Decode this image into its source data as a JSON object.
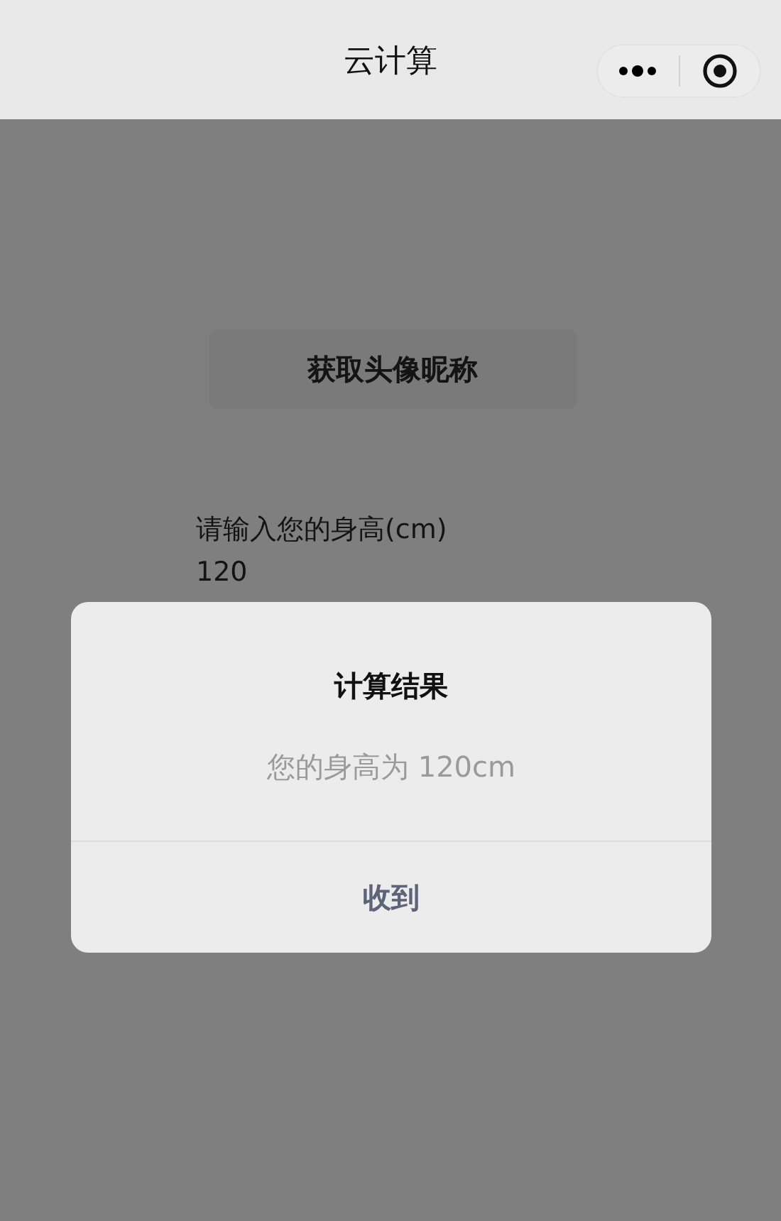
{
  "navbar": {
    "title": "云计算"
  },
  "page": {
    "button": "获取头像昵称",
    "field": {
      "label": "请输入您的身高(cm)",
      "value": "120"
    }
  },
  "dialog": {
    "title": "计算结果",
    "message": "您的身高为 120cm",
    "buttons": [
      "收到"
    ]
  }
}
